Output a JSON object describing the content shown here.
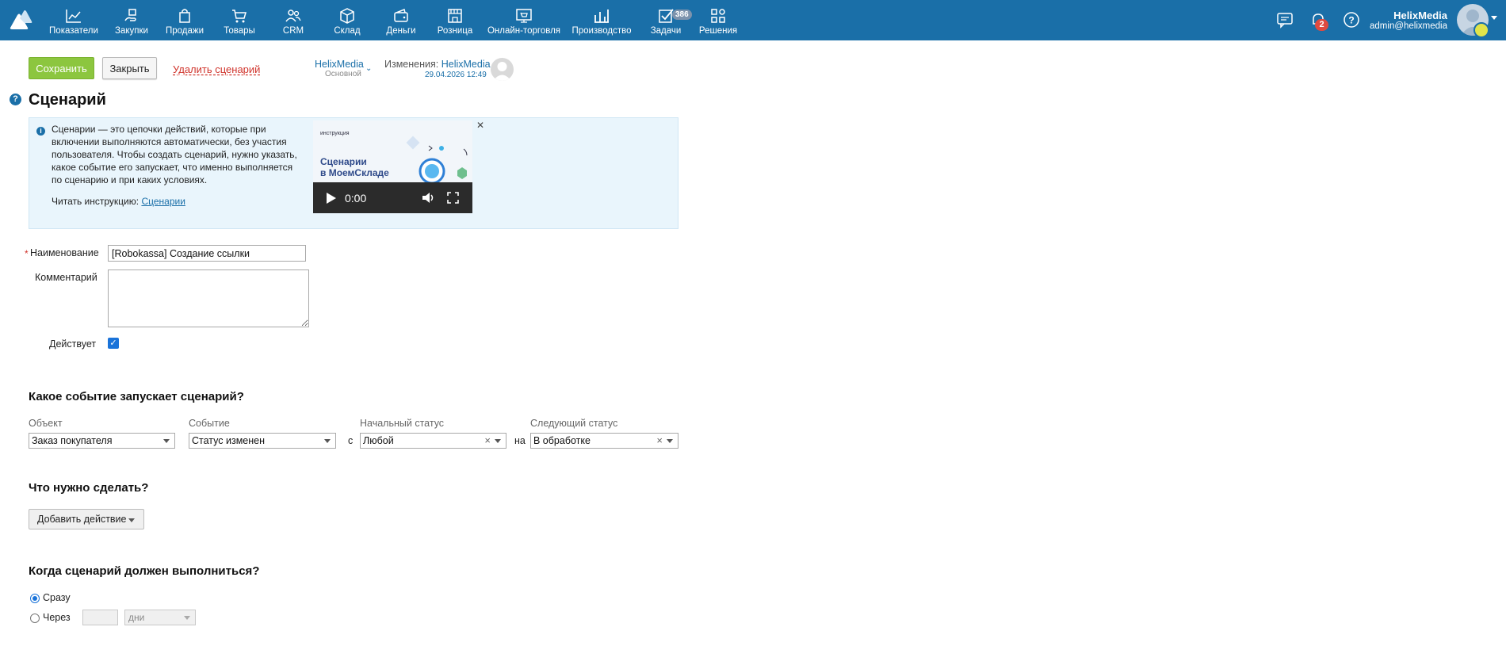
{
  "nav": {
    "items": [
      {
        "label": "Показатели",
        "icon": "chart-line-icon"
      },
      {
        "label": "Закупки",
        "icon": "hand-box-icon"
      },
      {
        "label": "Продажи",
        "icon": "shopping-bag-icon"
      },
      {
        "label": "Товары",
        "icon": "cart-icon"
      },
      {
        "label": "CRM",
        "icon": "people-icon"
      },
      {
        "label": "Склад",
        "icon": "box-icon"
      },
      {
        "label": "Деньги",
        "icon": "wallet-icon"
      },
      {
        "label": "Розница",
        "icon": "store-icon"
      },
      {
        "label": "Онлайн-торговля",
        "icon": "online-store-icon"
      },
      {
        "label": "Производство",
        "icon": "factory-icon"
      },
      {
        "label": "Задачи",
        "icon": "checkbox-icon",
        "badge": "386"
      },
      {
        "label": "Решения",
        "icon": "apps-grid-icon"
      }
    ],
    "notifications_count": "2",
    "user_name": "HelixMedia",
    "user_email": "admin@helixmedia"
  },
  "toolbar": {
    "save": "Сохранить",
    "close": "Закрыть",
    "delete": "Удалить сценарий",
    "owner": "HelixMedia",
    "owner_sub": "Основной",
    "changes_label": "Изменения:",
    "changes_user": "HelixMedia",
    "changes_date": "29.04.2026 12:49"
  },
  "page": {
    "title": "Сценарий",
    "help": "?"
  },
  "info": {
    "text": "Сценарии — это цепочки действий, которые при включении выполняются автоматически, без участия пользователя. Чтобы создать сценарий, нужно указать, какое событие его запускает, что именно выполняется по сценарию и при каких условиях.",
    "read_label": "Читать инструкцию:",
    "read_link": "Сценарии",
    "video_small": "инструкция",
    "video_title_1": "Сценарии",
    "video_title_2": "в МоемСкладе",
    "video_time": "0:00"
  },
  "form": {
    "name_label": "Наименование",
    "name_value": "[Robokassa] Создание ссылки",
    "comment_label": "Комментарий",
    "active_label": "Действует",
    "active": true
  },
  "trigger": {
    "heading": "Какое событие запускает сценарий?",
    "object_label": "Объект",
    "object_value": "Заказ покупателя",
    "event_label": "Событие",
    "event_value": "Статус изменен",
    "from_word": "с",
    "start_status_label": "Начальный статус",
    "start_status_value": "Любой",
    "to_word": "на",
    "next_status_label": "Следующий статус",
    "next_status_value": "В обработке"
  },
  "actions": {
    "heading": "Что нужно сделать?",
    "add_button": "Добавить действие"
  },
  "timing": {
    "heading": "Когда сценарий должен выполниться?",
    "now_label": "Сразу",
    "delay_label": "Через",
    "delay_unit": "дни",
    "selected": "now"
  },
  "colors": {
    "topbar": "#1a6fa8",
    "save_button": "#8cc63f",
    "link": "#1a6fa8",
    "danger": "#d0342c",
    "info_bg": "#e9f5fc"
  }
}
